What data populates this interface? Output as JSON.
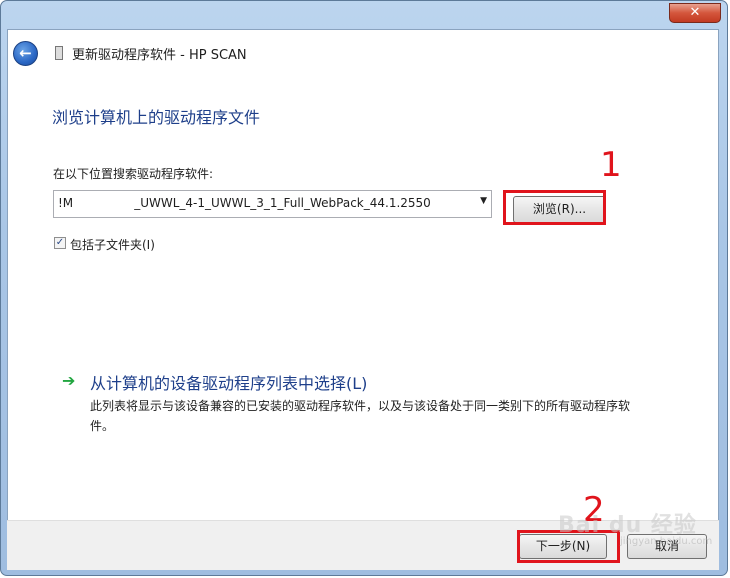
{
  "window": {
    "title": "更新驱动程序软件 - HP SCAN",
    "close_glyph": "✕"
  },
  "header": {
    "back_glyph": "←"
  },
  "page": {
    "title": "浏览计算机上的驱动程序文件",
    "search_label": "在以下位置搜索驱动程序软件:",
    "path_value": "!M                _UWWL_4-1_UWWL_3_1_Full_WebPack_44.1.2550",
    "combo_arrow": "▼",
    "browse_label": "浏览(R)...",
    "include_subfolders": {
      "label": "包括子文件夹(I)",
      "checked": true,
      "check_glyph": "✓"
    },
    "choose_option": {
      "arrow_glyph": "➔",
      "label": "从计算机的设备驱动程序列表中选择(L)",
      "description": "此列表将显示与该设备兼容的已安装的驱动程序软件，以及与该设备处于同一类别下的所有驱动程序软件。"
    }
  },
  "footer": {
    "next_label": "下一步(N)",
    "cancel_label": "取消"
  },
  "annotations": {
    "step1": "1",
    "step2": "2"
  },
  "watermark": {
    "text": "Bai du 经验",
    "sub": "jingyan.baidu.com"
  },
  "colors": {
    "highlight": "#e0141c",
    "title_blue": "#1e3f8a",
    "arrow_green": "#22a640"
  }
}
